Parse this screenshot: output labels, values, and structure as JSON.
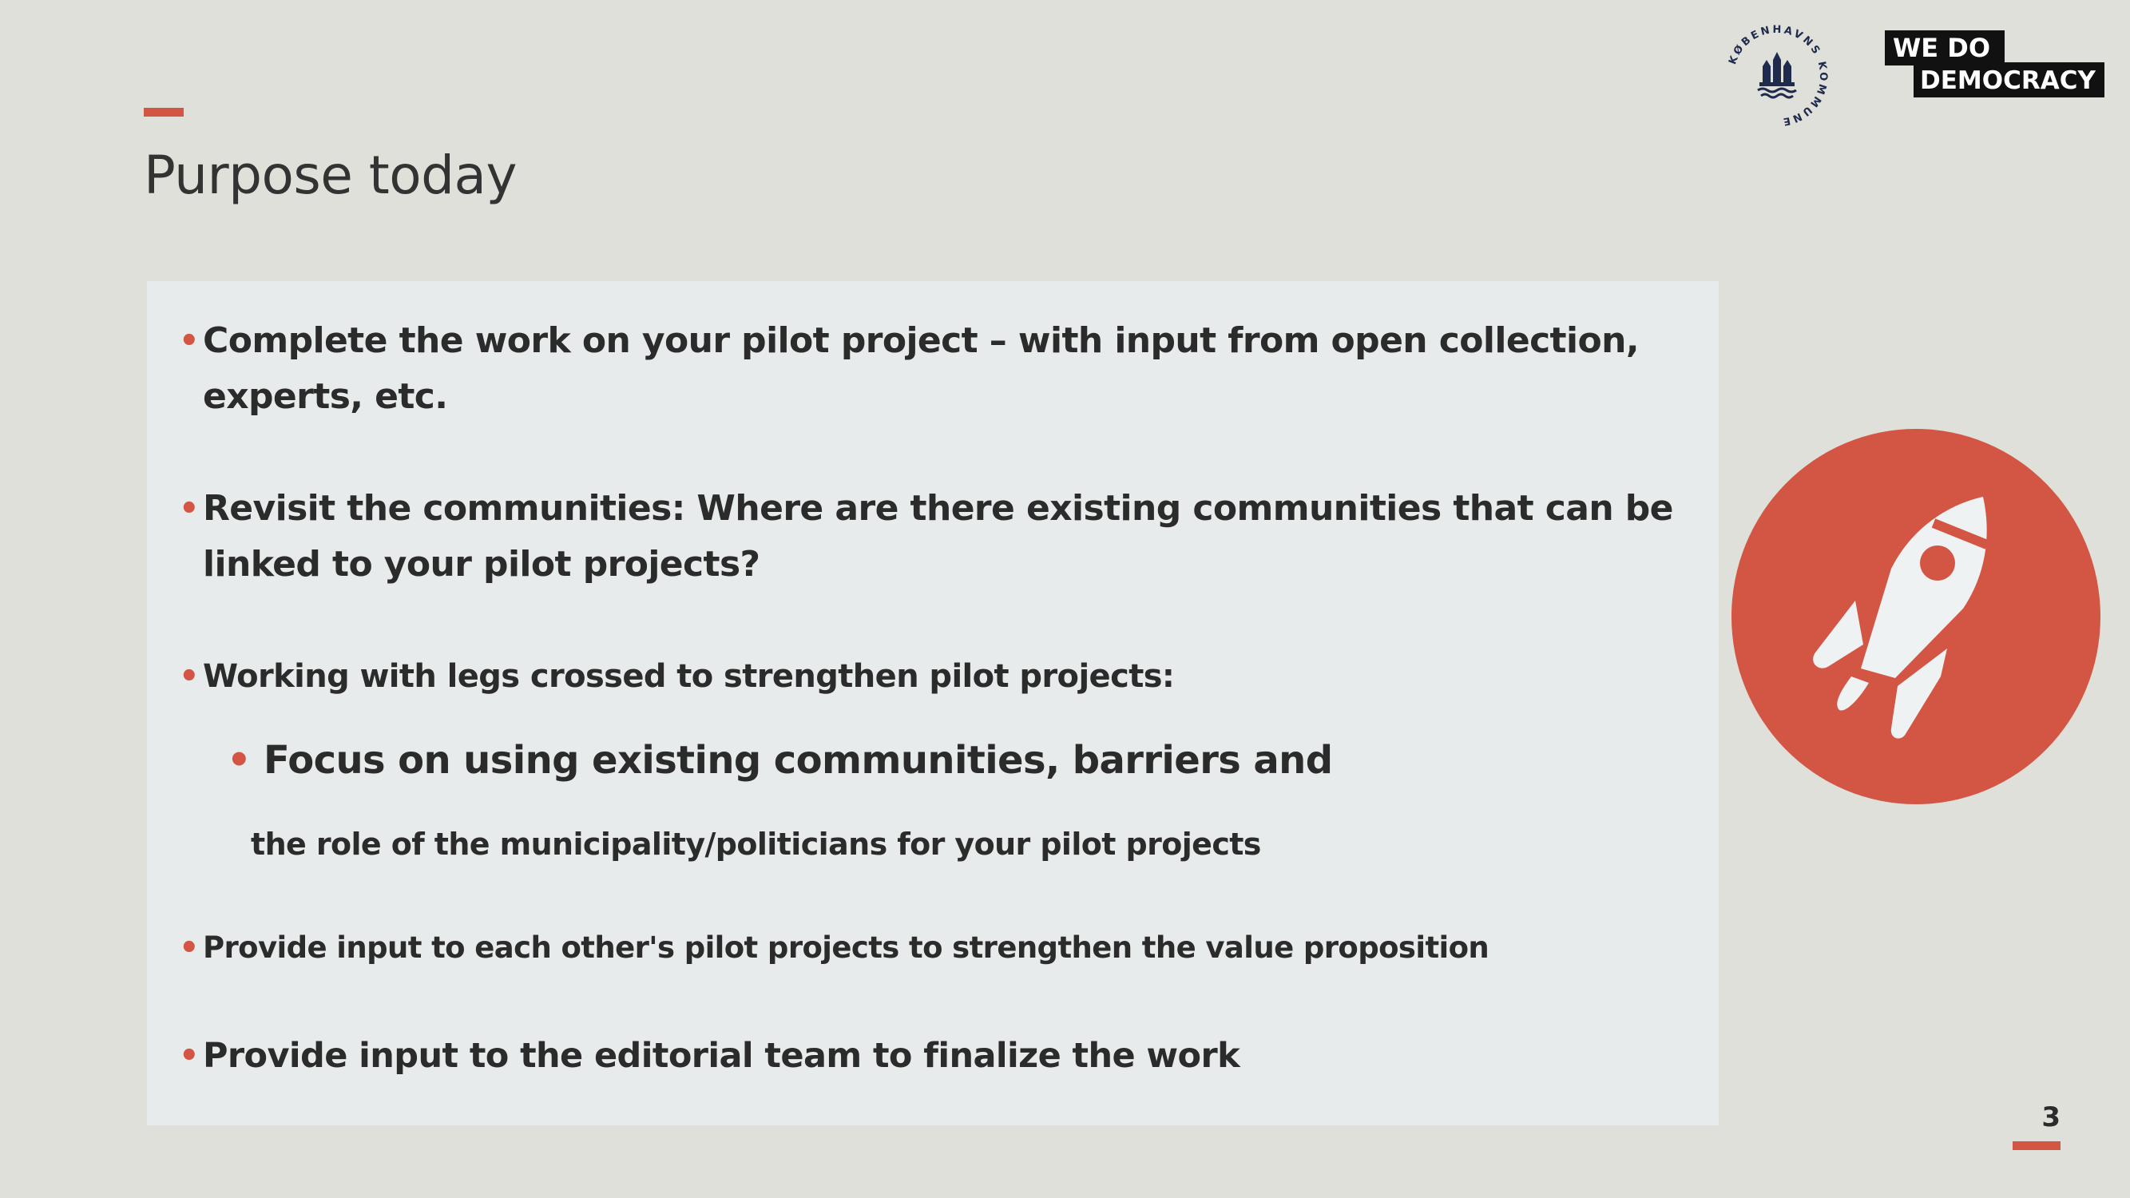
{
  "slide": {
    "title": "Purpose today",
    "page_number": "3"
  },
  "logos": {
    "seal_text": "KØBENHAVNS KOMMUNE",
    "wdd_line1": "WE DO",
    "wdd_line2": "DEMOCRACY"
  },
  "bullets": {
    "b1": "Complete the work on your pilot project – with input from open collection, experts, etc.",
    "b2": "Revisit the communities: Where are there existing communities that can be linked to your pilot projects?",
    "b3": "Working with legs crossed to strengthen pilot projects:",
    "b4": "Focus on using existing communities, barriers and",
    "b4_continued": "the role of the municipality/politicians for your pilot projects",
    "b5": "Provide input to each other's pilot projects to strengthen the value proposition",
    "b6": "Provide input to the editorial team to finalize the work"
  },
  "icons": {
    "bullet": "•",
    "rocket": "rocket-icon"
  },
  "colors": {
    "accent": "#d35543",
    "background": "#e0e0da",
    "panel": "#e8ebeb",
    "text": "#2b2b2b",
    "navy": "#1f2a4d"
  }
}
